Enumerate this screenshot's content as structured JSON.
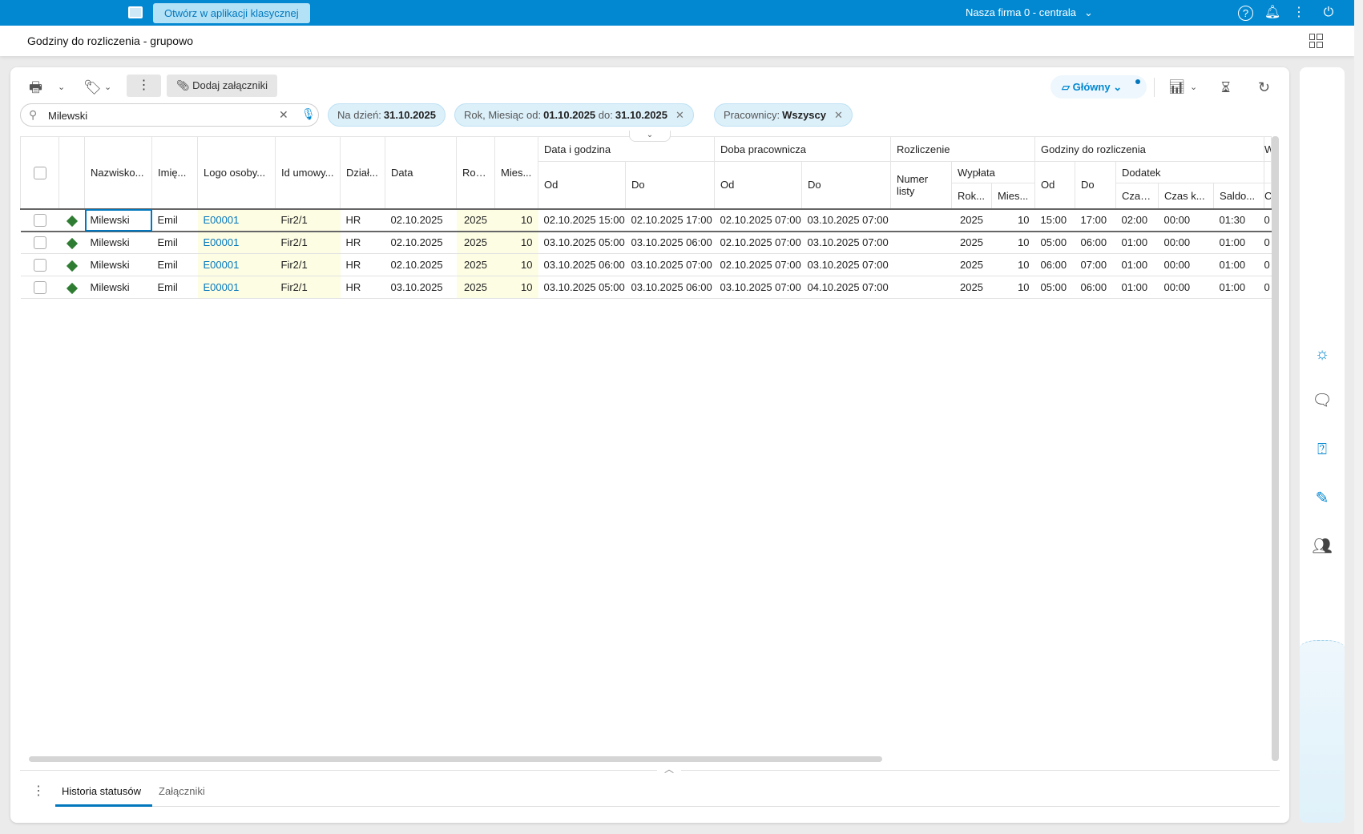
{
  "topbar": {
    "open_classic_label": "Otwórz w aplikacji klasycznej",
    "company": "Nasza firma 0 - centrala",
    "icons": [
      "classic-app-icon",
      "help-icon",
      "bell-icon",
      "more-icon",
      "power-icon"
    ],
    "accent": "#0288d1"
  },
  "header": {
    "title": "Godziny do rozliczenia - grupowo"
  },
  "toolbar": {
    "attach_label": "Dodaj załączniki",
    "view_label": "Główny"
  },
  "search": {
    "value": "Milewski"
  },
  "filters": [
    {
      "label": "Na dzień:",
      "value": "31.10.2025"
    },
    {
      "label": "Rok, Miesiąc od:",
      "value": "01.10.2025",
      "label2": "do:",
      "value2": "31.10.2025"
    },
    {
      "label": "Pracownicy:",
      "value": "Wszyscy"
    }
  ],
  "table": {
    "headers": {
      "nazwisko": "Nazwisko...",
      "imie": "Imię...",
      "logo": "Logo osoby...",
      "id_umowy": "Id umowy...",
      "dzial": "Dział...",
      "data": "Data",
      "rok": "Rok...",
      "mies": "Mies...",
      "data_godzina": "Data i godzina",
      "doba": "Doba pracownicza",
      "rozliczenie": "Rozliczenie",
      "godziny": "Godziny do rozliczenia",
      "od": "Od",
      "do": "Do",
      "numer_listy": "Numer listy",
      "wyplata": "Wypłata",
      "dodatek": "Dodatek",
      "czas": "Czas...",
      "czas_k": "Czas k...",
      "saldo": "Saldo...",
      "cut1": "W",
      "cut2": "C"
    },
    "rows": [
      {
        "cells": [
          "Milewski",
          "Emil",
          "E00001",
          "Fir2/1",
          "HR",
          "02.10.2025",
          "2025",
          "10",
          "02.10.2025 15:00",
          "02.10.2025 17:00",
          "02.10.2025 07:00",
          "03.10.2025 07:00",
          "",
          "2025",
          "10",
          "15:00",
          "17:00",
          "02:00",
          "00:00",
          "01:30",
          "0"
        ]
      },
      {
        "cells": [
          "Milewski",
          "Emil",
          "E00001",
          "Fir2/1",
          "HR",
          "02.10.2025",
          "2025",
          "10",
          "03.10.2025 05:00",
          "03.10.2025 06:00",
          "02.10.2025 07:00",
          "03.10.2025 07:00",
          "",
          "2025",
          "10",
          "05:00",
          "06:00",
          "01:00",
          "00:00",
          "01:00",
          "0"
        ]
      },
      {
        "cells": [
          "Milewski",
          "Emil",
          "E00001",
          "Fir2/1",
          "HR",
          "02.10.2025",
          "2025",
          "10",
          "03.10.2025 06:00",
          "03.10.2025 07:00",
          "02.10.2025 07:00",
          "03.10.2025 07:00",
          "",
          "2025",
          "10",
          "06:00",
          "07:00",
          "01:00",
          "00:00",
          "01:00",
          "0"
        ]
      },
      {
        "cells": [
          "Milewski",
          "Emil",
          "E00001",
          "Fir2/1",
          "HR",
          "03.10.2025",
          "2025",
          "10",
          "03.10.2025 05:00",
          "03.10.2025 06:00",
          "03.10.2025 07:00",
          "04.10.2025 07:00",
          "",
          "2025",
          "10",
          "05:00",
          "06:00",
          "01:00",
          "00:00",
          "01:00",
          "0"
        ]
      }
    ],
    "status_color": "#2e7d32"
  },
  "bottom": {
    "tabs": [
      {
        "label": "Historia statusów",
        "active": true
      },
      {
        "label": "Załączniki",
        "active": false
      }
    ]
  },
  "side_panel": {
    "icons": [
      "idea-icon",
      "chat-icon",
      "help-chat-icon",
      "feedback-edit-icon",
      "contact-icon"
    ]
  }
}
